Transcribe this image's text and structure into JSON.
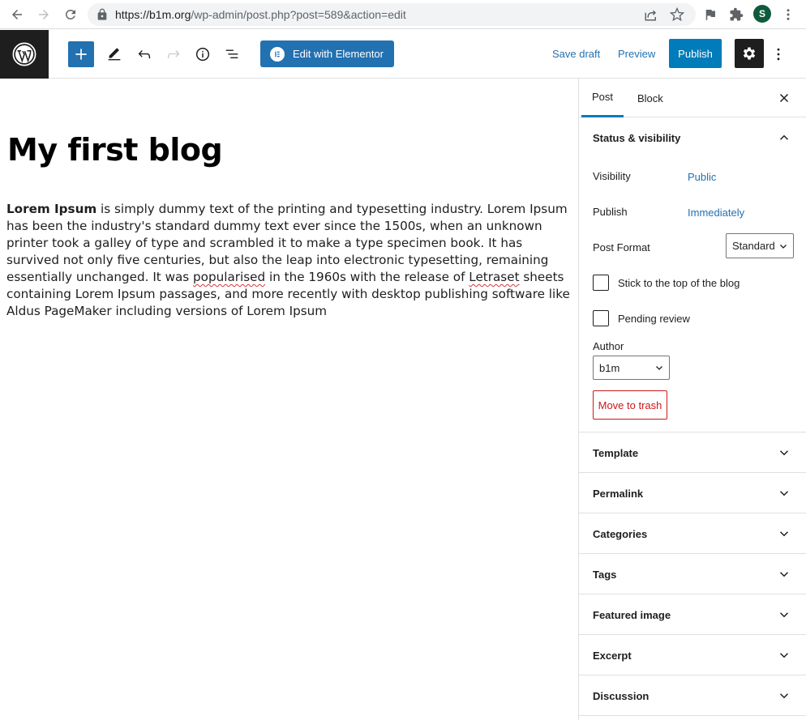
{
  "browser": {
    "url_host": "https://b1m.org",
    "url_path": "/wp-admin/post.php?post=589&action=edit",
    "profile_initial": "S"
  },
  "toolbar": {
    "elementor_label": "Edit with Elementor",
    "save_draft_label": "Save draft",
    "preview_label": "Preview",
    "publish_label": "Publish"
  },
  "post": {
    "title": "My first blog",
    "body_bold": "Lorem Ipsum",
    "body_part1": " is simply dummy text of the printing and typesetting industry. Lorem Ipsum has been the industry's standard dummy text ever since the 1500s, when an unknown printer took a galley of type and scrambled it to make a type specimen book. It has survived not only five centuries, but also the leap into electronic typesetting, remaining essentially unchanged. It was ",
    "body_misspell1": "popularised",
    "body_part2": " in the 1960s with the release of ",
    "body_misspell2": "Letraset",
    "body_part3": " sheets containing Lorem Ipsum passages, and more recently with desktop publishing software like Aldus PageMaker including versions of Lorem Ipsum"
  },
  "sidebar": {
    "tabs": [
      "Post",
      "Block"
    ],
    "status_visibility": {
      "title": "Status & visibility",
      "visibility_label": "Visibility",
      "visibility_value": "Public",
      "publish_label": "Publish",
      "publish_value": "Immediately",
      "post_format_label": "Post Format",
      "post_format_value": "Standard",
      "sticky_label": "Stick to the top of the blog",
      "pending_label": "Pending review",
      "author_label": "Author",
      "author_value": "b1m",
      "trash_label": "Move to trash"
    },
    "panels": [
      "Template",
      "Permalink",
      "Categories",
      "Tags",
      "Featured image",
      "Excerpt",
      "Discussion"
    ]
  },
  "colors": {
    "accent": "#2271b1",
    "publish": "#007cba",
    "danger": "#cc1818",
    "dark": "#1e1e1e"
  }
}
